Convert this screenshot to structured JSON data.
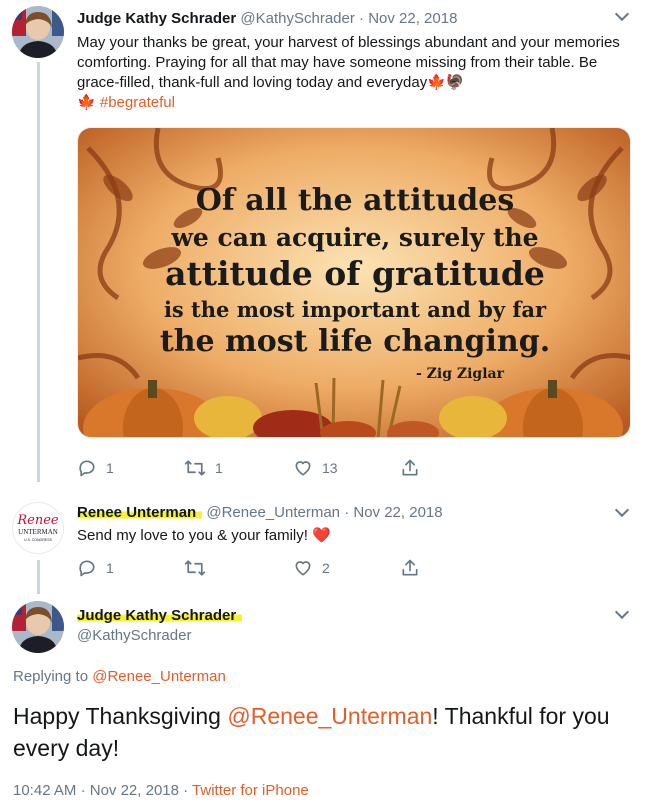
{
  "tweet1": {
    "author_name": "Judge Kathy Schrader",
    "author_handle": "@KathySchrader",
    "separator": "·",
    "date": "Nov 22, 2018",
    "text": "May your thanks be great, your harvest of blessings abundant and your memories comforting. Praying for all that may have someone missing from their table. Be grace-filled, thank-full and loving today and everyday",
    "emoji_end": "🍁🦃",
    "emoji_leaf": "🍁",
    "hashtag": "#begrateful",
    "image": {
      "line1": "Of all the attitudes",
      "line2": "we can acquire, surely the",
      "line3": "attitude of gratitude",
      "line4": "is the most important and by far",
      "line5": "the most life changing.",
      "attribution": "- Zig Ziglar"
    },
    "actions": {
      "replies": "1",
      "retweets": "1",
      "likes": "13"
    }
  },
  "tweet2": {
    "author_name": "Renee Unterman",
    "author_handle": "@Renee_Unterman",
    "separator": "·",
    "date": "Nov 22, 2018",
    "text": "Send my love to you & your family!",
    "emoji": "❤️",
    "avatar_logo": {
      "script": "Renee",
      "name": "UNTERMAN",
      "sub": "U.S. CONGRESS"
    },
    "actions": {
      "replies": "1",
      "retweets": "",
      "likes": "2"
    }
  },
  "tweet3": {
    "author_name": "Judge Kathy Schrader",
    "author_handle": "@KathySchrader",
    "replying_prefix": "Replying to",
    "replying_to": "@Renee_Unterman",
    "text_before": "Happy Thanksgiving ",
    "mention": "@Renee_Unterman",
    "text_after": "!  Thankful for you every day!",
    "time": "10:42 AM",
    "separator": "·",
    "date": "Nov 22, 2018",
    "source": "Twitter for iPhone"
  },
  "colors": {
    "accent": "#e0602b",
    "highlight": "#f7f130",
    "muted": "#657786",
    "heart": "#e0245e"
  }
}
